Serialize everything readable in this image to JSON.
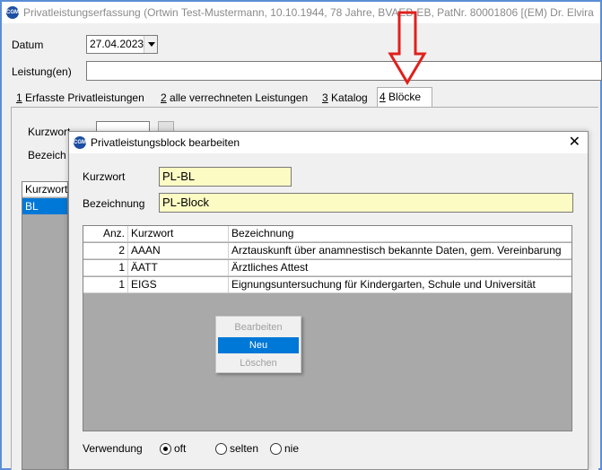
{
  "window": {
    "title": "Privatleistungserfassung (Ortwin Test-Mustermann, 10.10.1944, 78 Jahre, BVAEB-EB, PatNr. 80001806 [(EM) Dr. Elvira Muster])",
    "icon_text": "CGM"
  },
  "form": {
    "datum_label": "Datum",
    "datum_value": "27.04.2023",
    "leistung_label": "Leistung(en)",
    "leistung_value": ""
  },
  "tabs": [
    {
      "num": "1",
      "label": " Erfasste Privatleistungen"
    },
    {
      "num": "2",
      "label": " alle verrechneten Leistungen"
    },
    {
      "num": "3",
      "label": " Katalog"
    },
    {
      "num": "4",
      "label": " Blöcke"
    }
  ],
  "background_panel": {
    "kurzwort_label": "Kurzwort",
    "bezeichnung_label": "Bezeich",
    "list_header": "Kurzwort",
    "list_item": "BL"
  },
  "dialog": {
    "title": "Privatleistungsblock bearbeiten",
    "close": "✕",
    "kurzwort_label": "Kurzwort",
    "kurzwort_value": "PL-BL",
    "bezeichnung_label": "Bezeichnung",
    "bezeichnung_value": "PL-Block",
    "table": {
      "headers": [
        "Anz.",
        "Kurzwort",
        "Bezeichnung"
      ],
      "rows": [
        [
          "2",
          "AAAN",
          "Arztauskunft über anamnestisch bekannte Daten, gem. Vereinbarung"
        ],
        [
          "1",
          "ÄATT",
          "Ärztliches Attest"
        ],
        [
          "1",
          "EIGS",
          "Eignungsuntersuchung für Kindergarten, Schule und Universität"
        ]
      ]
    },
    "context_menu": [
      "Bearbeiten",
      "Neu",
      "Löschen"
    ],
    "verwendung_label": "Verwendung",
    "radio_options": [
      "oft",
      "selten",
      "nie"
    ],
    "radio_selected": "oft"
  },
  "annotation": {
    "arrow_color": "#e0201c"
  }
}
